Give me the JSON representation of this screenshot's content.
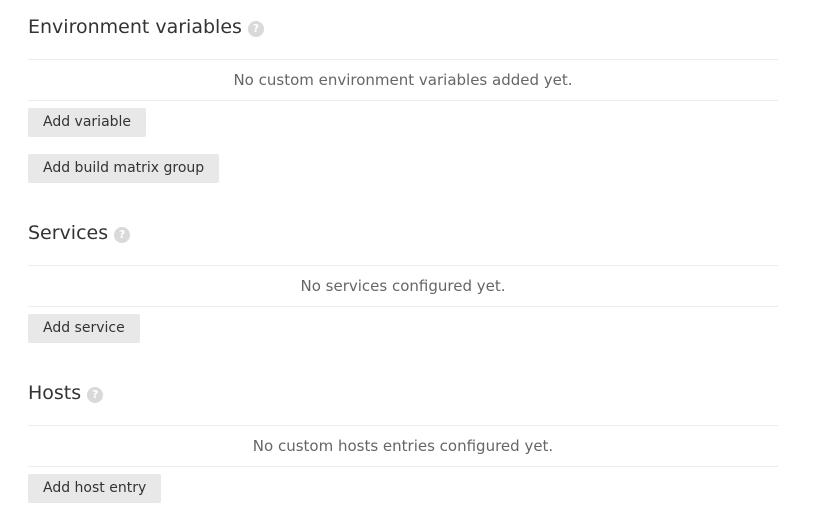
{
  "env": {
    "title": "Environment variables",
    "help_glyph": "?",
    "empty": "No custom environment variables added yet.",
    "add_variable": "Add variable",
    "add_matrix": "Add build matrix group"
  },
  "services": {
    "title": "Services",
    "help_glyph": "?",
    "empty": "No services configured yet.",
    "add_service": "Add service"
  },
  "hosts": {
    "title": "Hosts",
    "help_glyph": "?",
    "empty": "No custom hosts entries configured yet.",
    "add_host": "Add host entry"
  }
}
